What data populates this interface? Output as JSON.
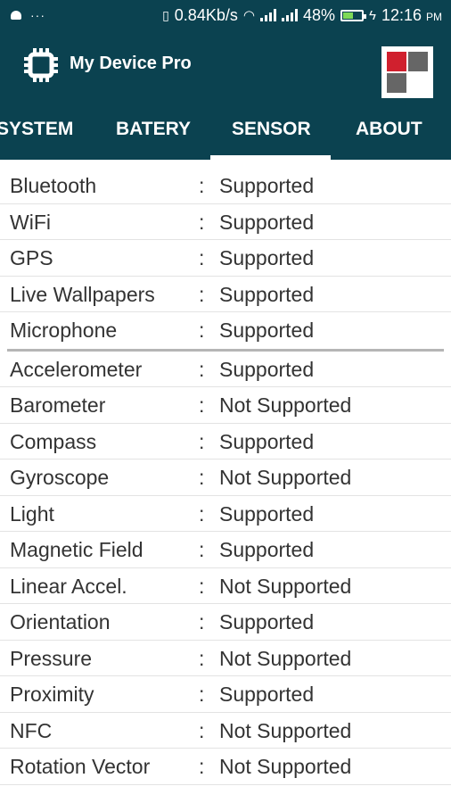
{
  "status_bar": {
    "net_speed": "0.84Kb/s",
    "battery_pct": "48%",
    "time_value": "12:16",
    "time_ampm": "PM",
    "dots": "···",
    "battery_level": 0.48
  },
  "app": {
    "title": "My Device Pro"
  },
  "tabs": [
    {
      "label": "SYSTEM"
    },
    {
      "label": "BATERY"
    },
    {
      "label": "SENSOR"
    },
    {
      "label": "ABOUT"
    }
  ],
  "selected_tab": "SENSOR",
  "colon": ":",
  "features": [
    {
      "name": "Bluetooth",
      "value": "Supported"
    },
    {
      "name": "WiFi",
      "value": "Supported"
    },
    {
      "name": "GPS",
      "value": "Supported"
    },
    {
      "name": "Live Wallpapers",
      "value": "Supported"
    },
    {
      "name": "Microphone",
      "value": "Supported"
    }
  ],
  "sensors": [
    {
      "name": "Accelerometer",
      "value": "Supported"
    },
    {
      "name": "Barometer",
      "value": "Not Supported"
    },
    {
      "name": "Compass",
      "value": "Supported"
    },
    {
      "name": "Gyroscope",
      "value": "Not Supported"
    },
    {
      "name": "Light",
      "value": "Supported"
    },
    {
      "name": "Magnetic Field",
      "value": "Supported"
    },
    {
      "name": "Linear Accel.",
      "value": "Not Supported"
    },
    {
      "name": "Orientation",
      "value": "Supported"
    },
    {
      "name": "Pressure",
      "value": "Not Supported"
    },
    {
      "name": "Proximity",
      "value": "Supported"
    },
    {
      "name": "NFC",
      "value": "Not Supported"
    },
    {
      "name": "Rotation Vector",
      "value": "Not Supported"
    }
  ],
  "colors": {
    "primary": "#0b4250",
    "logo_red": "#d0202e",
    "logo_gray": "#666666"
  }
}
